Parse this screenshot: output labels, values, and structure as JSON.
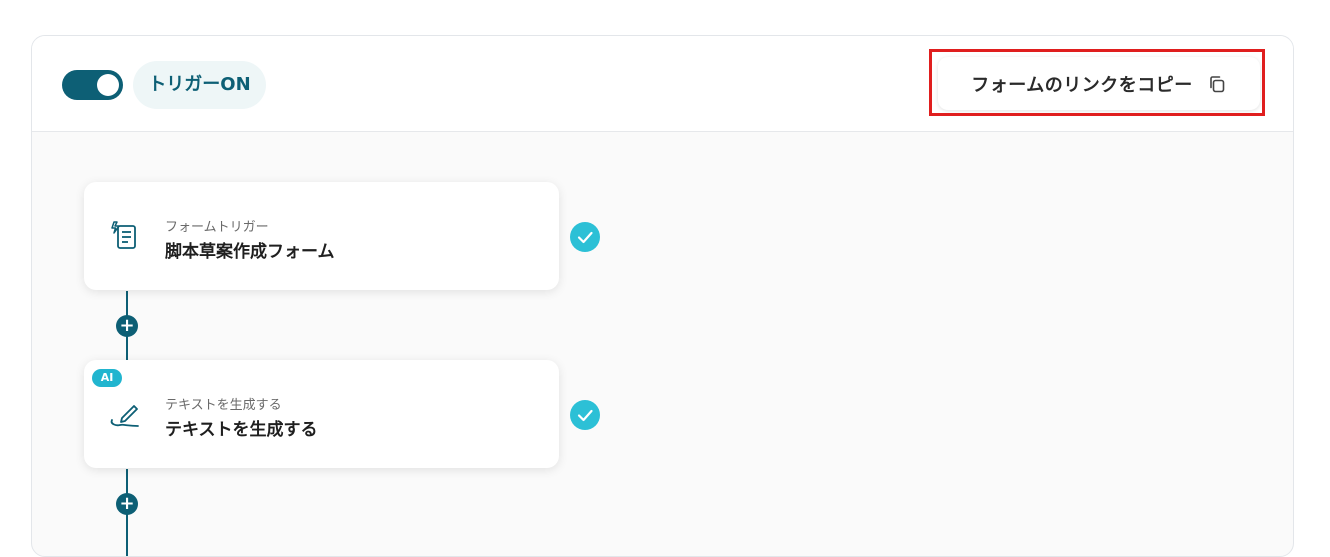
{
  "header": {
    "trigger_label": "トリガーON",
    "trigger_on": true,
    "copy_link_label": "フォームのリンクをコピー"
  },
  "flow": {
    "steps": [
      {
        "subtitle": "フォームトリガー",
        "title": "脚本草案作成フォーム",
        "icon": "form-icon",
        "status": "complete"
      },
      {
        "badge": "AI",
        "subtitle": "テキストを生成する",
        "title": "テキストを生成する",
        "icon": "pen-icon",
        "status": "complete"
      }
    ],
    "add_step_symbol": "+"
  },
  "colors": {
    "accent": "#0d5f75",
    "check": "#2cc0d6",
    "highlight": "#e01e1e"
  }
}
